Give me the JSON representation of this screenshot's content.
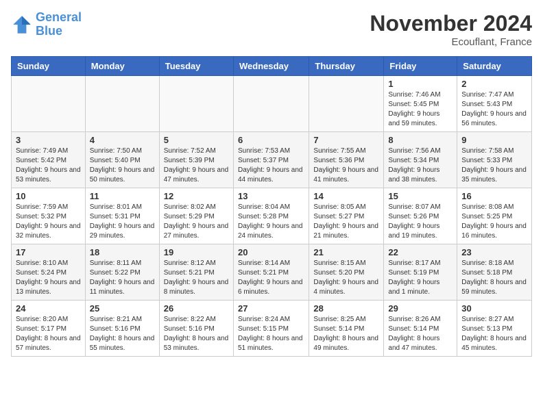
{
  "logo": {
    "line1": "General",
    "line2": "Blue"
  },
  "title": "November 2024",
  "location": "Ecouflant, France",
  "weekdays": [
    "Sunday",
    "Monday",
    "Tuesday",
    "Wednesday",
    "Thursday",
    "Friday",
    "Saturday"
  ],
  "weeks": [
    [
      {
        "day": "",
        "info": ""
      },
      {
        "day": "",
        "info": ""
      },
      {
        "day": "",
        "info": ""
      },
      {
        "day": "",
        "info": ""
      },
      {
        "day": "",
        "info": ""
      },
      {
        "day": "1",
        "info": "Sunrise: 7:46 AM\nSunset: 5:45 PM\nDaylight: 9 hours and 59 minutes."
      },
      {
        "day": "2",
        "info": "Sunrise: 7:47 AM\nSunset: 5:43 PM\nDaylight: 9 hours and 56 minutes."
      }
    ],
    [
      {
        "day": "3",
        "info": "Sunrise: 7:49 AM\nSunset: 5:42 PM\nDaylight: 9 hours and 53 minutes."
      },
      {
        "day": "4",
        "info": "Sunrise: 7:50 AM\nSunset: 5:40 PM\nDaylight: 9 hours and 50 minutes."
      },
      {
        "day": "5",
        "info": "Sunrise: 7:52 AM\nSunset: 5:39 PM\nDaylight: 9 hours and 47 minutes."
      },
      {
        "day": "6",
        "info": "Sunrise: 7:53 AM\nSunset: 5:37 PM\nDaylight: 9 hours and 44 minutes."
      },
      {
        "day": "7",
        "info": "Sunrise: 7:55 AM\nSunset: 5:36 PM\nDaylight: 9 hours and 41 minutes."
      },
      {
        "day": "8",
        "info": "Sunrise: 7:56 AM\nSunset: 5:34 PM\nDaylight: 9 hours and 38 minutes."
      },
      {
        "day": "9",
        "info": "Sunrise: 7:58 AM\nSunset: 5:33 PM\nDaylight: 9 hours and 35 minutes."
      }
    ],
    [
      {
        "day": "10",
        "info": "Sunrise: 7:59 AM\nSunset: 5:32 PM\nDaylight: 9 hours and 32 minutes."
      },
      {
        "day": "11",
        "info": "Sunrise: 8:01 AM\nSunset: 5:31 PM\nDaylight: 9 hours and 29 minutes."
      },
      {
        "day": "12",
        "info": "Sunrise: 8:02 AM\nSunset: 5:29 PM\nDaylight: 9 hours and 27 minutes."
      },
      {
        "day": "13",
        "info": "Sunrise: 8:04 AM\nSunset: 5:28 PM\nDaylight: 9 hours and 24 minutes."
      },
      {
        "day": "14",
        "info": "Sunrise: 8:05 AM\nSunset: 5:27 PM\nDaylight: 9 hours and 21 minutes."
      },
      {
        "day": "15",
        "info": "Sunrise: 8:07 AM\nSunset: 5:26 PM\nDaylight: 9 hours and 19 minutes."
      },
      {
        "day": "16",
        "info": "Sunrise: 8:08 AM\nSunset: 5:25 PM\nDaylight: 9 hours and 16 minutes."
      }
    ],
    [
      {
        "day": "17",
        "info": "Sunrise: 8:10 AM\nSunset: 5:24 PM\nDaylight: 9 hours and 13 minutes."
      },
      {
        "day": "18",
        "info": "Sunrise: 8:11 AM\nSunset: 5:22 PM\nDaylight: 9 hours and 11 minutes."
      },
      {
        "day": "19",
        "info": "Sunrise: 8:12 AM\nSunset: 5:21 PM\nDaylight: 9 hours and 8 minutes."
      },
      {
        "day": "20",
        "info": "Sunrise: 8:14 AM\nSunset: 5:21 PM\nDaylight: 9 hours and 6 minutes."
      },
      {
        "day": "21",
        "info": "Sunrise: 8:15 AM\nSunset: 5:20 PM\nDaylight: 9 hours and 4 minutes."
      },
      {
        "day": "22",
        "info": "Sunrise: 8:17 AM\nSunset: 5:19 PM\nDaylight: 9 hours and 1 minute."
      },
      {
        "day": "23",
        "info": "Sunrise: 8:18 AM\nSunset: 5:18 PM\nDaylight: 8 hours and 59 minutes."
      }
    ],
    [
      {
        "day": "24",
        "info": "Sunrise: 8:20 AM\nSunset: 5:17 PM\nDaylight: 8 hours and 57 minutes."
      },
      {
        "day": "25",
        "info": "Sunrise: 8:21 AM\nSunset: 5:16 PM\nDaylight: 8 hours and 55 minutes."
      },
      {
        "day": "26",
        "info": "Sunrise: 8:22 AM\nSunset: 5:16 PM\nDaylight: 8 hours and 53 minutes."
      },
      {
        "day": "27",
        "info": "Sunrise: 8:24 AM\nSunset: 5:15 PM\nDaylight: 8 hours and 51 minutes."
      },
      {
        "day": "28",
        "info": "Sunrise: 8:25 AM\nSunset: 5:14 PM\nDaylight: 8 hours and 49 minutes."
      },
      {
        "day": "29",
        "info": "Sunrise: 8:26 AM\nSunset: 5:14 PM\nDaylight: 8 hours and 47 minutes."
      },
      {
        "day": "30",
        "info": "Sunrise: 8:27 AM\nSunset: 5:13 PM\nDaylight: 8 hours and 45 minutes."
      }
    ]
  ]
}
